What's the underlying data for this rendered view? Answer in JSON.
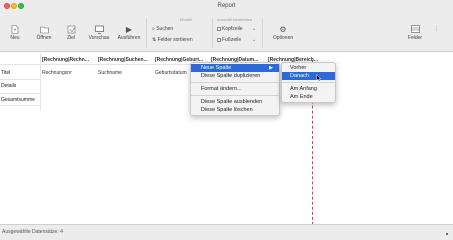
{
  "window": {
    "title": "Report"
  },
  "toolbar": {
    "buttons": [
      {
        "id": "new",
        "label": "Neu",
        "icon": "new-icon"
      },
      {
        "id": "open",
        "label": "Öffnen",
        "icon": "folder-icon"
      },
      {
        "id": "save",
        "label": "Ziel",
        "icon": "target-icon"
      },
      {
        "id": "preview",
        "label": "Vorschau",
        "icon": "preview-icon"
      },
      {
        "id": "run",
        "label": "Ausführen",
        "icon": "play-icon"
      }
    ],
    "group1_label": "Modell",
    "group1_items": [
      "Suchen",
      "Felder sortieren"
    ],
    "group2_label": "Auswahl bearbeiten",
    "group2_items": [
      "Kopfzeile",
      "Fußzeile"
    ],
    "options_label": "Optionen",
    "right_button_label": "Felder"
  },
  "table": {
    "column_headers": [
      "[Rechnung|Rechn...",
      "[Rechnung|Suchen...",
      "[Rechnung|Geburt...",
      "[Rechnung|Datum...",
      "[Rechnung|Bereich..."
    ],
    "row_labels": [
      "Titel",
      "Details",
      "Gesamtsumme"
    ],
    "cells": [
      "Rechnungsnr",
      "Suchname",
      "Geburtsdatum"
    ]
  },
  "context_menu": {
    "items": [
      {
        "label": "Neue Spalte",
        "has_submenu": true,
        "active": true
      },
      {
        "label": "Diese Spalte duplizieren",
        "has_submenu": false,
        "active": false
      },
      {
        "separator": true
      },
      {
        "label": "Format ändern...",
        "has_submenu": false,
        "active": false
      },
      {
        "separator": true
      },
      {
        "label": "Diese Spalte ausblenden",
        "has_submenu": false,
        "active": false
      },
      {
        "label": "Diese Spalte löschen",
        "has_submenu": false,
        "active": false
      }
    ]
  },
  "submenu": {
    "items": [
      {
        "label": "Vorher",
        "active": false
      },
      {
        "label": "Danach",
        "active": true
      },
      {
        "separator": true
      },
      {
        "label": "Am Anfang",
        "active": false
      },
      {
        "label": "Am Ende",
        "active": false
      }
    ]
  },
  "status": {
    "text": "Ausgewählte Datensätze: 4"
  },
  "colors": {
    "accent": "#2b6ad8",
    "guide_line": "#e04040"
  }
}
